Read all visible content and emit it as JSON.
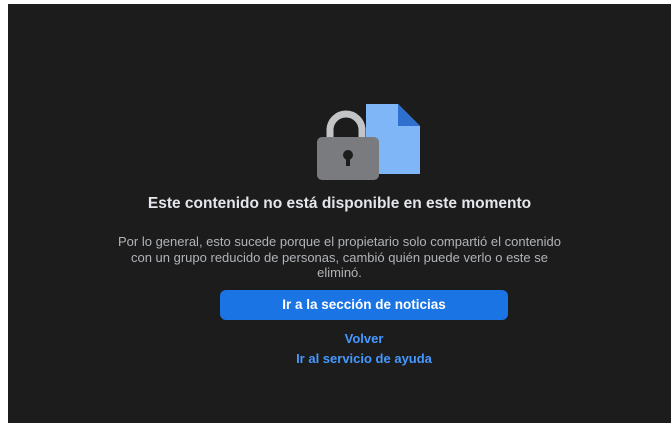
{
  "error_page": {
    "title": "Este contenido no está disponible en este momento",
    "description": "Por lo general, esto sucede porque el propietario solo compartió el contenido con un grupo reducido de personas, cambió quién puede verlo o este se eliminó.",
    "primary_button_label": "Ir a la sección de noticias",
    "back_link_label": "Volver",
    "help_link_label": "Ir al servicio de ayuda"
  },
  "icons": {
    "illustration": "locked-document-icon"
  },
  "colors": {
    "background": "#1c1c1d",
    "primary_button": "#1b74e4",
    "link": "#4599ff",
    "title_text": "#e4e6eb",
    "body_text": "#b0b3b8",
    "document": "#7fb6f7",
    "lock_body": "#7a7b7e",
    "lock_shackle": "#c3c4c6"
  }
}
